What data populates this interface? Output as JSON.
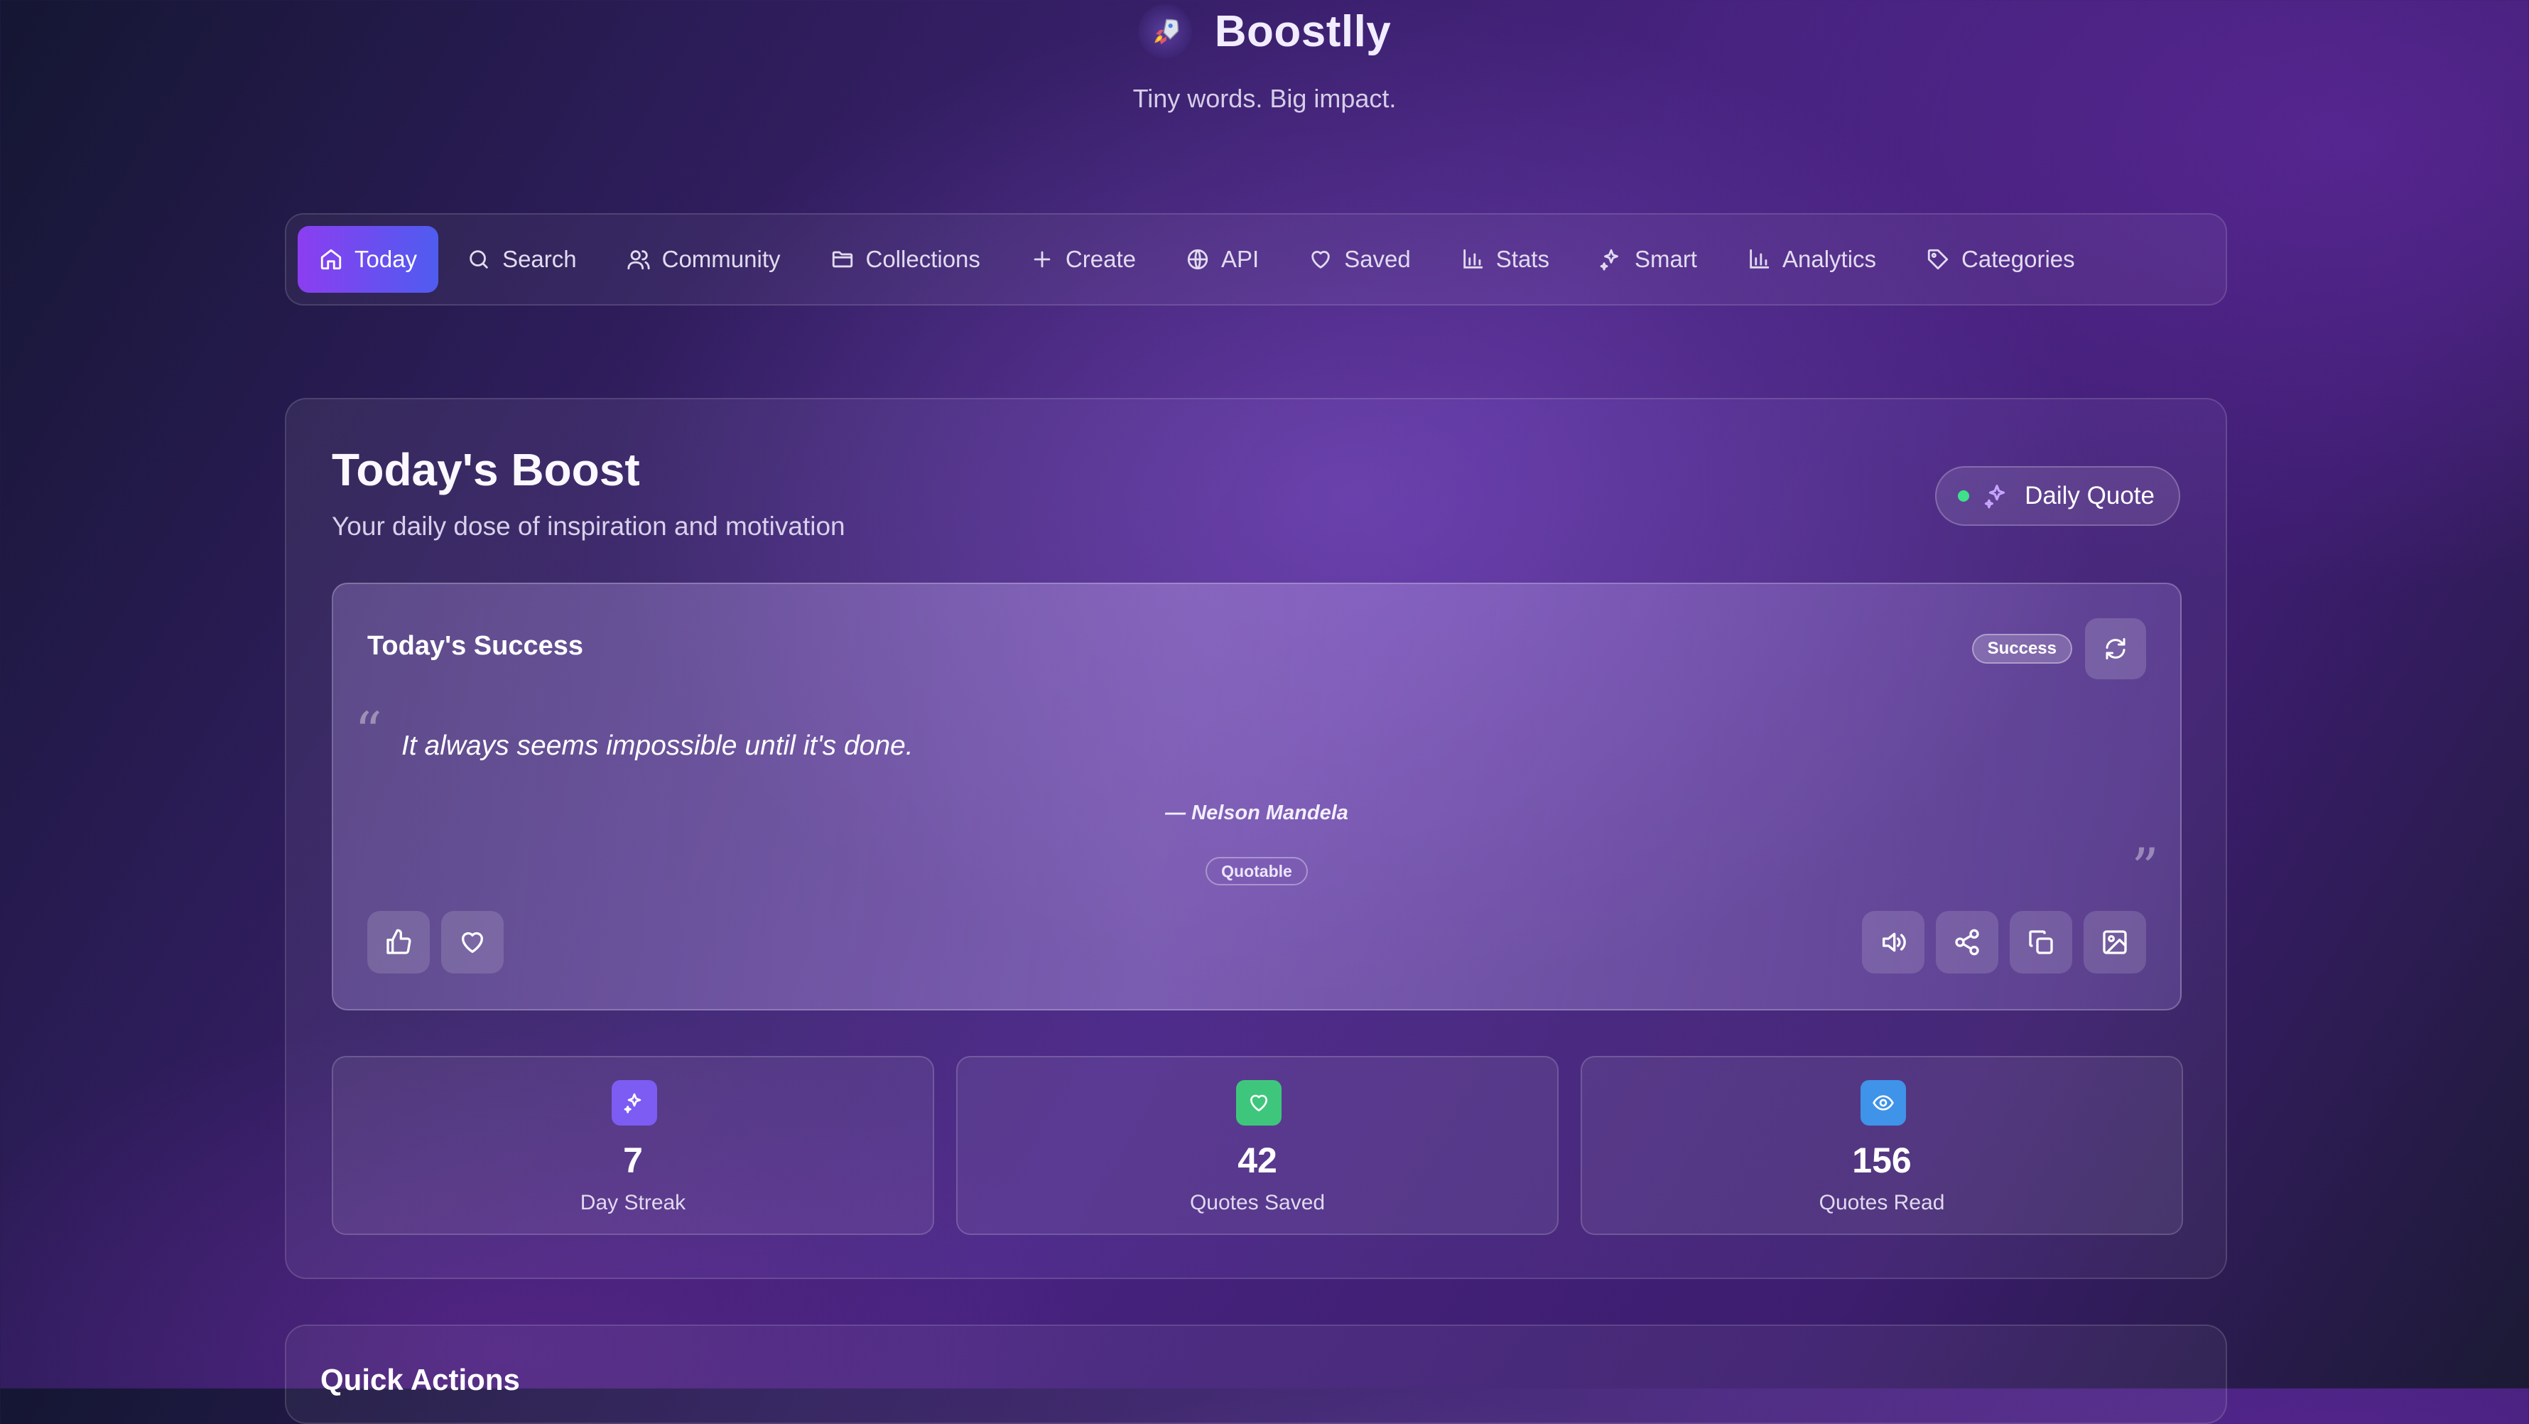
{
  "app": {
    "logo_icon": "rocket-icon",
    "name": "Boostlly",
    "tagline": "Tiny words. Big impact."
  },
  "nav": {
    "active": "Today",
    "tabs": [
      {
        "label": "Today",
        "icon": "home-icon"
      },
      {
        "label": "Search",
        "icon": "search-icon"
      },
      {
        "label": "Community",
        "icon": "users-icon"
      },
      {
        "label": "Collections",
        "icon": "folder-icon"
      },
      {
        "label": "Create",
        "icon": "plus-icon"
      },
      {
        "label": "API",
        "icon": "globe-icon"
      },
      {
        "label": "Saved",
        "icon": "heart-icon"
      },
      {
        "label": "Stats",
        "icon": "bar-chart-icon"
      },
      {
        "label": "Smart",
        "icon": "sparkles-icon"
      },
      {
        "label": "Analytics",
        "icon": "bar-chart-icon"
      },
      {
        "label": "Categories",
        "icon": "tag-icon"
      }
    ]
  },
  "boost": {
    "title": "Today's Boost",
    "subtitle": "Your daily dose of inspiration and motivation",
    "daily_quote_label": "Daily Quote"
  },
  "quote_card": {
    "title": "Today's Success",
    "category_badge": "Success",
    "text": "It always seems impossible until it's done.",
    "author": "— Nelson Mandela",
    "source": "Quotable"
  },
  "stats": [
    {
      "value": "7",
      "label": "Day Streak",
      "icon": "sparkles-icon",
      "color": "#7c5cf2"
    },
    {
      "value": "42",
      "label": "Quotes Saved",
      "icon": "heart-icon",
      "color": "#3ec77c"
    },
    {
      "value": "156",
      "label": "Quotes Read",
      "icon": "eye-icon",
      "color": "#3f93e8"
    }
  ],
  "quick_actions": {
    "title": "Quick Actions"
  },
  "colors": {
    "accent_gradient_start": "#8b3ef0",
    "accent_gradient_end": "#4f5cf0",
    "status_dot": "#3fe08a"
  }
}
